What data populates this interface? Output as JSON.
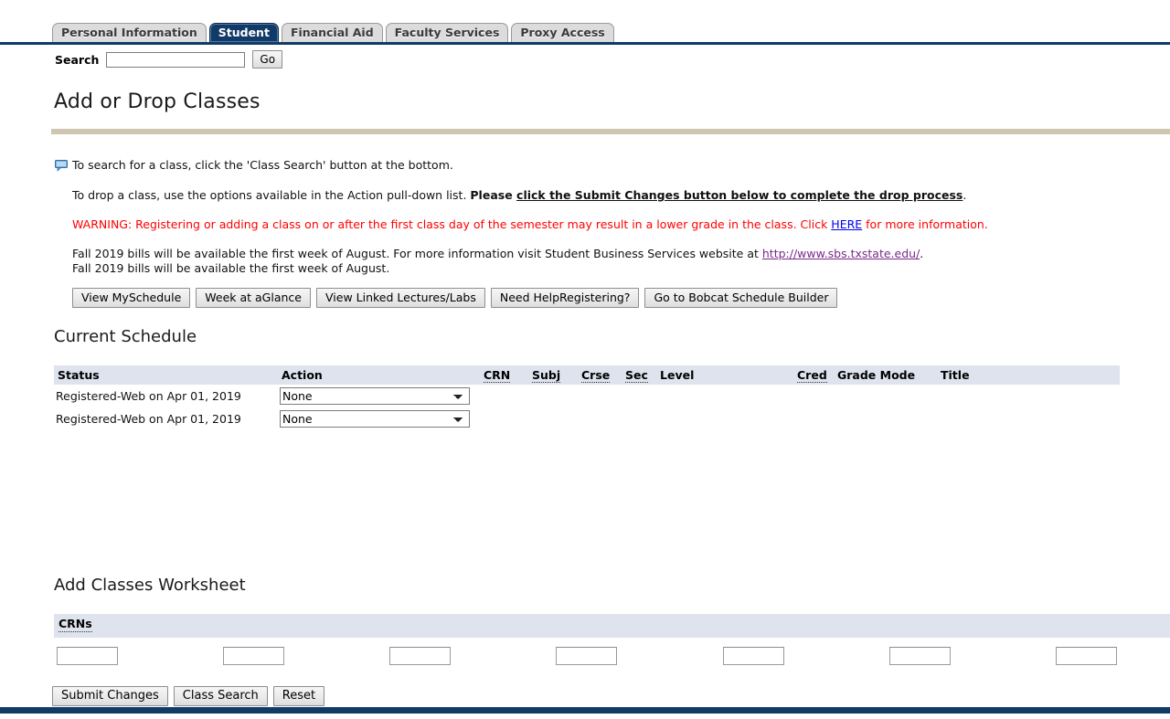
{
  "nav": {
    "tabs": [
      {
        "label": "Personal Information",
        "active": false
      },
      {
        "label": "Student",
        "active": true
      },
      {
        "label": "Financial Aid",
        "active": false
      },
      {
        "label": "Faculty Services",
        "active": false
      },
      {
        "label": "Proxy Access",
        "active": false
      }
    ]
  },
  "search": {
    "label": "Search",
    "value": "",
    "placeholder": "",
    "go_label": "Go"
  },
  "page": {
    "title": "Add or Drop Classes"
  },
  "instructions": {
    "icon": "callout-icon",
    "search_hint": "To search for a class, click the 'Class Search' button at the bottom.",
    "drop_prefix": "To drop a class, use the options available in the Action pull-down list. ",
    "drop_bold_lead": "Please ",
    "drop_bold_underline": "click the Submit Changes button below to complete the drop process",
    "drop_suffix": ".",
    "warning_prefix": "WARNING: Registering or adding a class on or after the first class day of the semester may result in a lower grade in the class. Click ",
    "warning_link": "HERE",
    "warning_suffix": " for more information.",
    "bills_prefix": "Fall 2019 bills will be available the first week of August. For more information visit Student Business Services website at ",
    "bills_link": "http://www.sbs.txstate.edu/",
    "bills_suffix": ".",
    "bills_line2": "Fall 2019 bills will be available the first week of August."
  },
  "action_buttons": [
    {
      "label": "View MySchedule"
    },
    {
      "label": "Week at aGlance"
    },
    {
      "label": "View Linked Lectures/Labs"
    },
    {
      "label": "Need HelpRegistering?"
    },
    {
      "label": "Go to Bobcat Schedule Builder"
    }
  ],
  "current_schedule": {
    "heading": "Current Schedule",
    "columns": [
      {
        "label": "Status",
        "hint": false
      },
      {
        "label": "Action",
        "hint": false
      },
      {
        "label": "CRN",
        "hint": true
      },
      {
        "label": "Subj",
        "hint": true
      },
      {
        "label": "Crse",
        "hint": true
      },
      {
        "label": "Sec",
        "hint": true
      },
      {
        "label": "Level",
        "hint": false
      },
      {
        "label": "Cred",
        "hint": true
      },
      {
        "label": "Grade Mode",
        "hint": false
      },
      {
        "label": "Title",
        "hint": false
      }
    ],
    "rows": [
      {
        "status": "Registered-Web on Apr 01, 2019",
        "action": "None",
        "crn": "",
        "subj": "",
        "crse": "",
        "sec": "",
        "level": "",
        "cred": "",
        "grade_mode": "",
        "title": ""
      },
      {
        "status": "Registered-Web on Apr 01, 2019",
        "action": "None",
        "crn": "",
        "subj": "",
        "crse": "",
        "sec": "",
        "level": "",
        "cred": "",
        "grade_mode": "",
        "title": ""
      }
    ],
    "action_options": [
      "None"
    ]
  },
  "worksheet": {
    "heading": "Add Classes Worksheet",
    "crns_label": "CRNs",
    "crn_values": [
      "",
      "",
      "",
      "",
      "",
      "",
      ""
    ]
  },
  "bottom_buttons": [
    {
      "label": "Submit Changes"
    },
    {
      "label": "Class Search"
    },
    {
      "label": "Reset"
    }
  ],
  "colors": {
    "nav_navy": "#123a67",
    "rule_tan": "#cfc5b0",
    "table_header": "#dfe3ee",
    "warning_red": "#ff0000",
    "link_blue": "#0000ee",
    "link_visited": "#7a2a8a"
  }
}
